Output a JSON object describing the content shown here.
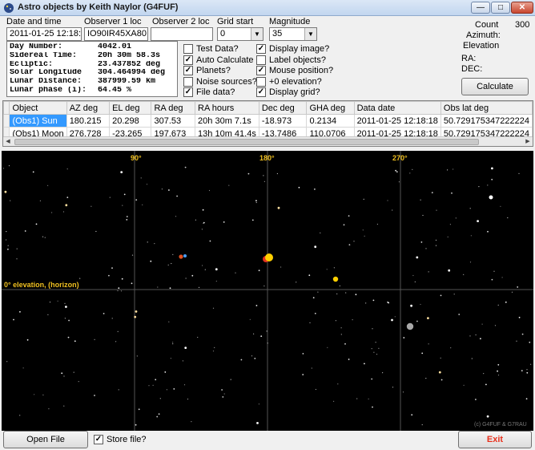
{
  "window": {
    "title": "Astro objects by Keith Naylor (G4FUF)"
  },
  "controls": {
    "date_label": "Date and time",
    "date_value": "2011-01-25 12:18:18",
    "obs1_label": "Observer 1 loc",
    "obs1_value": "IO90IR45XA80",
    "obs2_label": "Observer 2 loc",
    "obs2_value": "",
    "grid_start_label": "Grid start",
    "grid_start_value": "0",
    "magnitude_label": "Magnitude",
    "magnitude_value": "35",
    "count_label": "Count",
    "count_value": "300",
    "azimuth_label": "Azimuth:",
    "elevation_label": "Elevation",
    "ra_label": "RA:",
    "dec_label": "DEC:",
    "calculate_label": "Calculate"
  },
  "info": [
    {
      "k": "Day Number:",
      "v": "4042.01"
    },
    {
      "k": "Sidereal Time:",
      "v": "20h 30m 58.3s"
    },
    {
      "k": "Ecliptic:",
      "v": "23.437852 deg"
    },
    {
      "k": "Solar Longitude",
      "v": "304.464994 deg"
    },
    {
      "k": "Lunar Distance:",
      "v": "387999.59 km"
    },
    {
      "k": "Lunar phase (i):",
      "v": "64.45 %"
    }
  ],
  "checkboxes": [
    {
      "label": "Test Data?",
      "checked": false
    },
    {
      "label": "Auto Calculate",
      "checked": true
    },
    {
      "label": "Planets?",
      "checked": true
    },
    {
      "label": "Noise sources?",
      "checked": false
    },
    {
      "label": "File data?",
      "checked": true
    },
    {
      "label": "Display image?",
      "checked": true
    },
    {
      "label": "Label objects?",
      "checked": false
    },
    {
      "label": "Mouse position?",
      "checked": true
    },
    {
      "label": "+0 elevation?",
      "checked": false
    },
    {
      "label": "Display grid?",
      "checked": true
    }
  ],
  "table": {
    "columns": [
      "Object",
      "AZ deg",
      "EL deg",
      "RA deg",
      "RA hours",
      "Dec deg",
      "GHA deg",
      "Data date",
      "Obs lat deg"
    ],
    "rows": [
      [
        "(Obs1) Sun",
        "180.215",
        "20.298",
        "307.53",
        "20h 30m 7.1s",
        "-18.973",
        "0.2134",
        "2011-01-25 12:18:18",
        "50.729175347222224"
      ],
      [
        "(Obs1) Moon",
        "276.728",
        "-23.265",
        "197.673",
        "13h 10m 41.4s",
        "-13.7486",
        "110.0706",
        "2011-01-25 12:18:18",
        "50.729175347222224"
      ]
    ]
  },
  "sky": {
    "az_labels": [
      "90°",
      "180°",
      "270°"
    ],
    "horizon_label": "0° elevation, (horizon)",
    "copyright": "(c) G4FUF & G7RAU",
    "grid_color": "#555555",
    "label_color": "#f0c020"
  },
  "bottom": {
    "open_file_label": "Open File",
    "store_file_label": "Store file?",
    "store_file_checked": true,
    "exit_label": "Exit",
    "exit_color": "#e8301c"
  }
}
